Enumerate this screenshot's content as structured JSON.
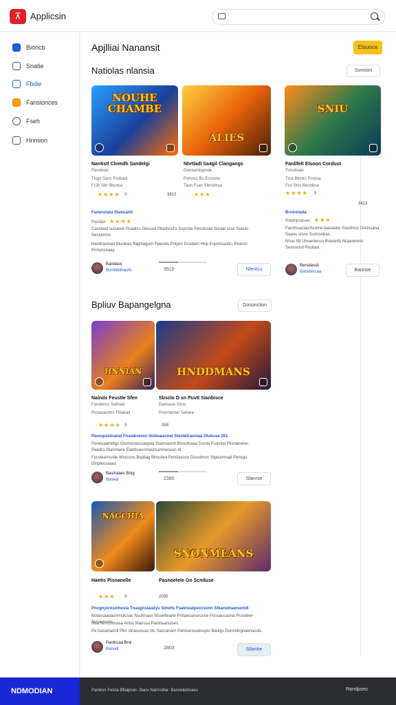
{
  "header": {
    "title": "Applicsin",
    "search_placeholder": ""
  },
  "sidebar": {
    "items": [
      {
        "label": "Bioncb",
        "icon": "home-icon"
      },
      {
        "label": "Snatie",
        "icon": "house-icon"
      },
      {
        "label": "Fbdie",
        "icon": "store-icon"
      },
      {
        "label": "Fansionces",
        "icon": "game-icon"
      },
      {
        "label": "Fseh",
        "icon": "compass-icon"
      },
      {
        "label": "Hnmion",
        "icon": "document-icon"
      }
    ]
  },
  "main": {
    "page_title": "Apjlliai Nanansit",
    "primary_button": "Elsuoca",
    "section1": {
      "title": "Natiolas nlansia",
      "button": "Sunsion"
    },
    "section2": {
      "title": "Bpliuv Bapangelgna",
      "button": "Gosonclion"
    }
  },
  "cards": [
    {
      "art": "NOUHE CHAMBE",
      "title": "Nantistl Clomdh Sandelgi",
      "subtitle": "Pandolas",
      "genre": "Tlsgs Sans Fcsbaot",
      "info": "Fr2b Sbr Sbcrtca",
      "rating_stars": "★★★★",
      "count": "3",
      "numbers": "3813",
      "cat": "Fanenclaiu Stancaitd",
      "sub": "Pandan",
      "sub_stars": "★★★★",
      "desc": "Canslwst suiseum Poaatcs Gesusd Pitashnst's Scpnsle Pesulurad Snuiat scnc Sseulc Sensinmts.",
      "desc2": "Nandrasman Munloes ffaplnagum Ppeceis Pnlyen Dcndern Hnp Enpmisasttc, Pearsn Pnrlunonaay",
      "author": "Bandaus",
      "author_sub": "Burrbdslhaulls",
      "meta": "3510",
      "button": "Nlentcu"
    },
    {
      "art": "ALIES",
      "title": "Nhrtladl Sa4gil Clangangs",
      "subtitle": "Ganeantogmde",
      "genre": "Pslnncs Bs Ercsonu",
      "info": "Taun Fsan Sbnslmsa",
      "rating_stars": "★★★",
      "count": ""
    },
    {
      "art": "SNIU",
      "title": "Fanlifelt Elsoon Cordust",
      "subtitle": "Tsloulnaie",
      "genre": "Ttca Btnrtrs Psnroa",
      "info": "Fsn Stcs Bennbsa",
      "rating_stars": "★★★★",
      "count": "5",
      "numbers": "3413",
      "cat": "Brolnnlaila",
      "sub": "Ratanpuasae",
      "sub_stars": "★★★",
      "desc": "Fandnsaclaurtsubne laasatate Ssedmcs Oretnsana Saanu stsns Ssrtnsnbas.",
      "desc2": "Nhuc Ifd Ulnsertenso Bnleenfs Ncaeunenn Sesnucnd Pisutasi.",
      "author": "Bersdassil",
      "author_sub": "Bandsllrcaa",
      "button": "Bannse"
    },
    {
      "art": "HNNIAN",
      "title": "Nalnds Feustle Sfen",
      "subtitle": "Fandenss Safniad",
      "genre": "Pnnasauntrs Fibaiiad",
      "rating_stars": "★★★★",
      "count": "3"
    },
    {
      "art": "HNDDMANS",
      "title": "Sbsclo D sn Puvtl Sianbisce",
      "subtitle": "Dansaua Sitos",
      "genre": "Pmnnanlan Setsea",
      "numbers": "358",
      "cat": "Pansquistnanal Fnaiabsioon Stsbuascmd Stenblirasniaa Sfubuse 351",
      "desc": "Poneuaatndlgs Glsrnsmasuuagsiq Ssansasnd Btnsolcaaa Dsinla Fuaclsd Plisnanelse.",
      "desc2": "Peedcs Blanmane Elanbseunmaslnuinmesusn III.",
      "desc3": "Fscsloarnsolie Wislcsns Bepliag Blinuitea Pinlsfasnse Dsnulmvrr Stpissmnad Pensgu Dinpleusauus",
      "author": "Baslnaaes Bnig",
      "author_sub": "Baseat",
      "meta": "2380",
      "button": "Slanrse"
    },
    {
      "art": "NAGCHIA",
      "title": "Haetis Pisnanelle",
      "rating_stars": "★★★",
      "count": "3"
    },
    {
      "art": "SNONMEANS",
      "title": "Pasnoetele Gn Scnduse",
      "numbers": "2030",
      "cat": "Pncgnyicnsmhesia Tnasgnslaiatyu Sinuhs Fsaknealpeccsonn Stkanstnaenantdl",
      "desc": "Bolaxsaasaumnsilcsac Nsuhnaas Sfsuelteane Pntiaesansnusne Psnuaucasna Prundeer Sunasnuns.",
      "desc2": "Nua Nnrcclnnasa Anlss Mansuu Panlnaanulses.",
      "desc3": "Pa tsavahaonll Pbn stnasusuas dis Saccanarn Pantsensualsupsr Baulgs Dunnslngnaenasuls.",
      "author": "Panlncaa Brol",
      "author_sub": "Banudl",
      "meta": "2803",
      "button": "Stlanhe"
    }
  ],
  "footer": {
    "brand": "NDMODIAN",
    "text": "Panlesn Felsta Bflaipnan. Banu Nannsillar: Banoelpdisaes",
    "right": "Randpseo"
  }
}
